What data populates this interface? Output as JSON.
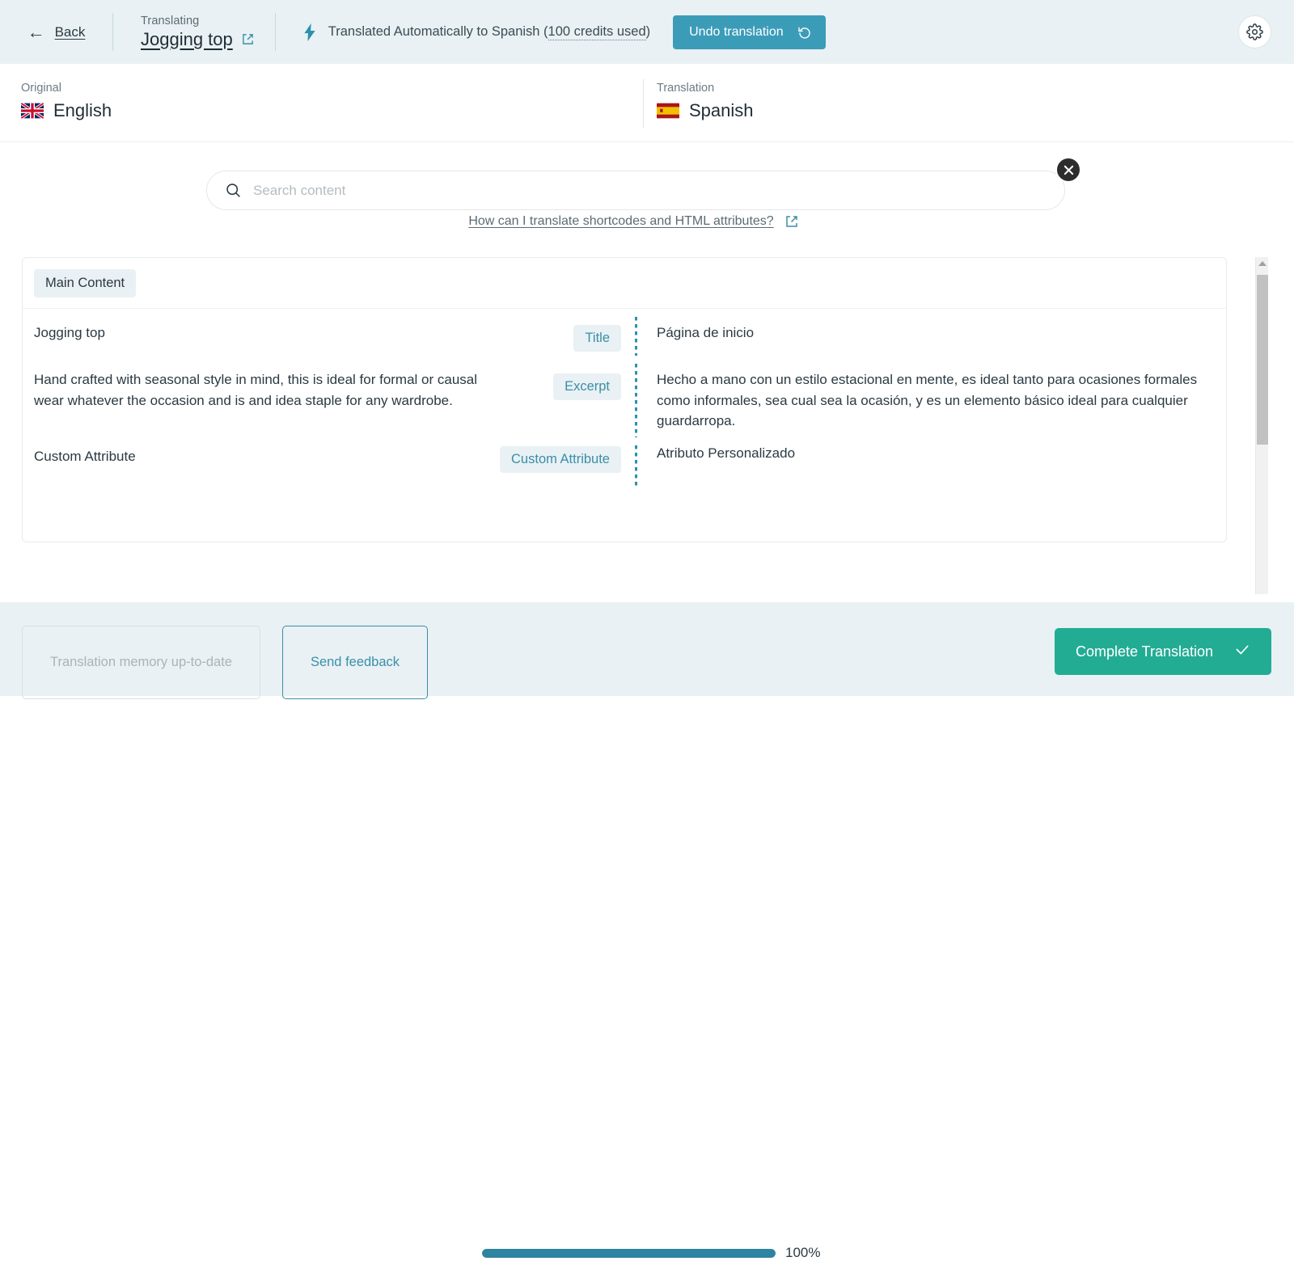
{
  "header": {
    "back_label": "Back",
    "translating_caption": "Translating",
    "translating_title": "Jogging top",
    "status_prefix": "Translated Automatically to Spanish (",
    "status_credits": "100 credits used",
    "status_suffix": ")",
    "undo_label": "Undo translation",
    "accent_blue": "#3b9cb8",
    "bar_background": "#e9f1f4"
  },
  "languages": {
    "original_caption": "Original",
    "original_name": "English",
    "translation_caption": "Translation",
    "translation_name": "Spanish"
  },
  "search": {
    "placeholder": "Search content",
    "value": "",
    "help_text": "How can I translate shortcodes and HTML attributes?"
  },
  "content": {
    "section_label": "Main Content",
    "rows": [
      {
        "source": "Jogging top",
        "field": "Title",
        "target": "Página de inicio"
      },
      {
        "source": "Hand crafted with seasonal style in mind, this is ideal for formal or causal wear whatever the occasion and is and idea staple for any wardrobe.",
        "field": "Excerpt",
        "target": "Hecho a mano con un estilo estacional en mente, es ideal tanto para ocasiones formales como informales, sea cual sea la ocasión, y es un elemento básico ideal para cualquier guardarropa."
      },
      {
        "source": "Custom Attribute",
        "field": "Custom Attribute",
        "target": "Atributo Personalizado"
      }
    ]
  },
  "footer": {
    "tm_label": "Translation memory up-to-date",
    "feedback_label": "Send feedback",
    "progress_percent": "100%",
    "progress_value": 100,
    "complete_label": "Complete Translation",
    "complete_color": "#23ac94",
    "progress_color": "#2e83a0"
  }
}
